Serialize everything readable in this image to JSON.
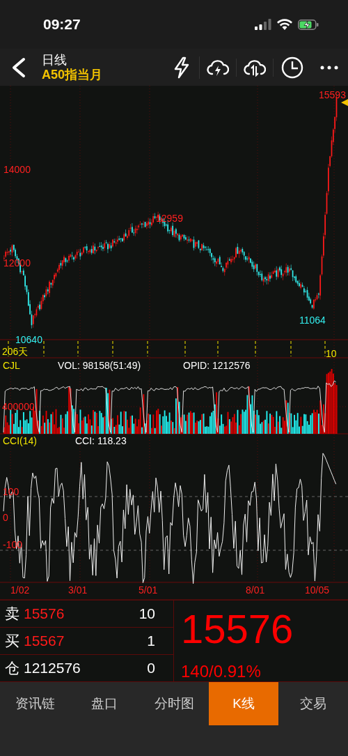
{
  "status_bar": {
    "time": "09:27"
  },
  "header": {
    "title": "日线",
    "subtitle": "A50指当月"
  },
  "price_panel": {
    "max_label": "15593",
    "axis_labels": [
      "14000",
      "12000"
    ],
    "high_label": "12959",
    "low_label": "11064",
    "min_label": "10640",
    "period": "206天",
    "day_marker": "10"
  },
  "volume_panel": {
    "name": "CJL",
    "vol": "VOL: 98158(51:49)",
    "opid": "OPID: 1212576",
    "axis_label": "400000"
  },
  "cci_panel": {
    "name": "CCI(14)",
    "value": "CCI: 118.23",
    "axis_labels": [
      "100",
      "0",
      "-100"
    ]
  },
  "dates": [
    "1/02",
    "3/01",
    "5/01",
    "8/01",
    "10/05"
  ],
  "quote": {
    "rows": [
      {
        "label": "卖",
        "price": "15576",
        "qty": "10",
        "kind": "quote"
      },
      {
        "label": "买",
        "price": "15567",
        "qty": "1",
        "kind": "quote"
      },
      {
        "label": "仓",
        "price": "1212576",
        "qty": "0",
        "kind": "position"
      }
    ],
    "last": "15576",
    "change": "140/0.91%"
  },
  "tabs": [
    {
      "label": "资讯链",
      "selected": false
    },
    {
      "label": "盘口",
      "selected": false
    },
    {
      "label": "分时图",
      "selected": false
    },
    {
      "label": "K线",
      "selected": true
    },
    {
      "label": "交易",
      "selected": false
    }
  ]
}
